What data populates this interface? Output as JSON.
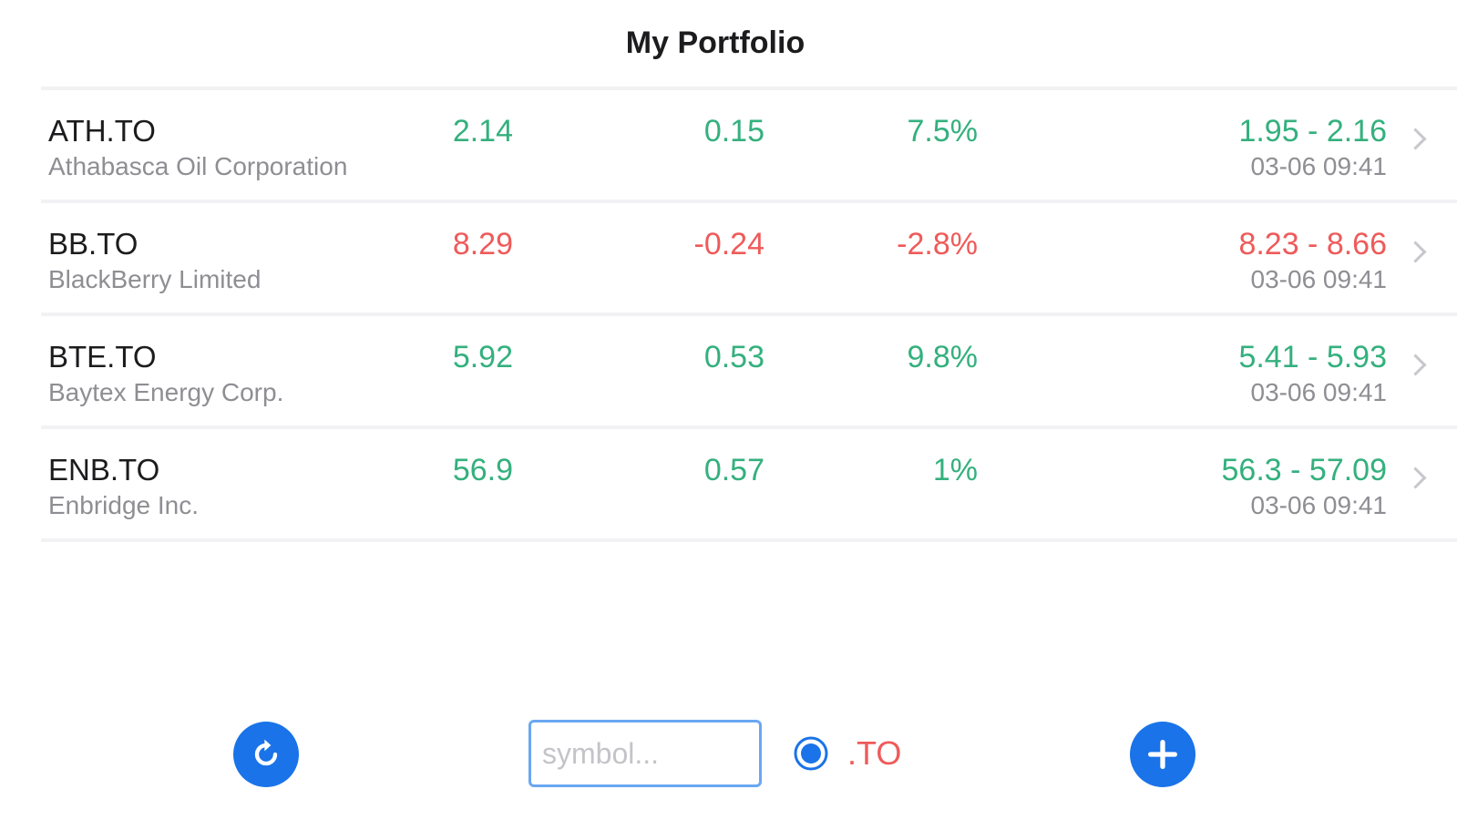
{
  "header": {
    "title": "My Portfolio"
  },
  "colors": {
    "up": "#34b07e",
    "down": "#ef5a5a",
    "accent": "#1a73e8"
  },
  "stocks": [
    {
      "symbol": "ATH.TO",
      "name": "Athabasca Oil Corporation",
      "price": "2.14",
      "change": "0.15",
      "percent": "7.5%",
      "range": "1.95 - 2.16",
      "time": "03-06 09:41",
      "direction": "up"
    },
    {
      "symbol": "BB.TO",
      "name": "BlackBerry Limited",
      "price": "8.29",
      "change": "-0.24",
      "percent": "-2.8%",
      "range": "8.23 - 8.66",
      "time": "03-06 09:41",
      "direction": "down"
    },
    {
      "symbol": "BTE.TO",
      "name": "Baytex Energy Corp.",
      "price": "5.92",
      "change": "0.53",
      "percent": "9.8%",
      "range": "5.41 - 5.93",
      "time": "03-06 09:41",
      "direction": "up"
    },
    {
      "symbol": "ENB.TO",
      "name": "Enbridge Inc.",
      "price": "56.9",
      "change": "0.57",
      "percent": "1%",
      "range": "56.3 - 57.09",
      "time": "03-06 09:41",
      "direction": "up"
    }
  ],
  "toolbar": {
    "refresh_icon": "refresh-icon",
    "add_icon": "plus-icon",
    "search": {
      "placeholder": "symbol...",
      "value": ""
    },
    "suffix": {
      "label": ".TO",
      "checked": true
    }
  }
}
